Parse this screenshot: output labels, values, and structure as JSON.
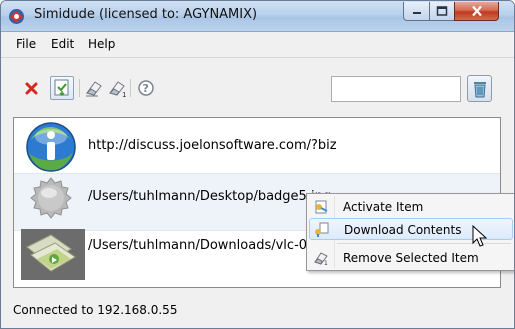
{
  "window": {
    "title": "Simidude (licensed to: AGYNAMIX)"
  },
  "menu": {
    "file": "File",
    "edit": "Edit",
    "help": "Help"
  },
  "toolbar": {
    "icons": [
      "delete-icon",
      "download-icon",
      "eraser-icon",
      "eraser-all-icon",
      "help-icon"
    ],
    "search_value": "",
    "trash_icon": "trash-icon"
  },
  "items": [
    {
      "icon": "info-globe-icon",
      "text": "http://discuss.joelonsoftware.com/?biz"
    },
    {
      "icon": "badge-icon",
      "text": "/Users/tuhlmann/Desktop/badge5.jpg"
    },
    {
      "icon": "vlc-package-icon",
      "text": "/Users/tuhlmann/Downloads/vlc-0.9"
    }
  ],
  "context_menu": {
    "activate": "Activate Item",
    "download": "Download Contents",
    "remove": "Remove Selected Item"
  },
  "status": {
    "text": "Connected to 192.168.0.55"
  },
  "colors": {
    "selection_highlight": "#dcebfb",
    "close_button": "#c0391f",
    "title_bar": "#b9d1ec"
  }
}
